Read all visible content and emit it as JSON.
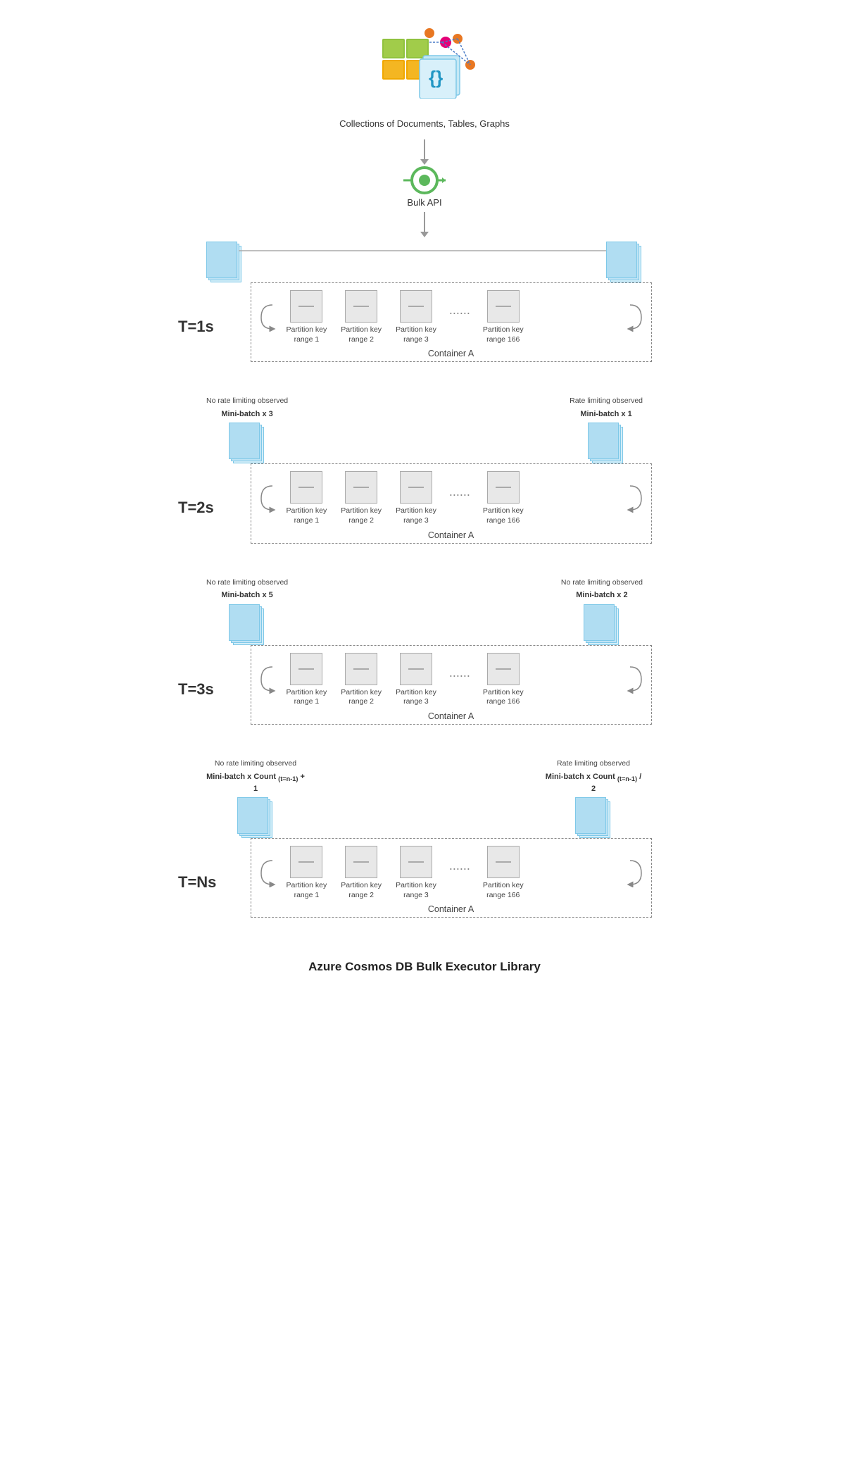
{
  "header": {
    "collections_label": "Collections of Documents, Tables, Graphs",
    "bulk_api_label": "Bulk API"
  },
  "sections": [
    {
      "time_label": "T=1s",
      "left_note": null,
      "left_batch_label": null,
      "right_note": null,
      "right_batch_label": null,
      "has_top_bar": true,
      "container_label": "Container A",
      "partitions": [
        {
          "label": "Partition key\nrange 1"
        },
        {
          "label": "Partition key\nrange 2"
        },
        {
          "label": "Partition key\nrange 3"
        },
        {
          "label": "Partition key\nrange 166"
        }
      ]
    },
    {
      "time_label": "T=2s",
      "left_note_line1": "No rate limiting observed",
      "left_note_line2": "Mini-batch x 3",
      "right_note_line1": "Rate limiting observed",
      "right_note_line2": "Mini-batch x 1",
      "container_label": "Container A",
      "partitions": [
        {
          "label": "Partition key\nrange 1"
        },
        {
          "label": "Partition key\nrange 2"
        },
        {
          "label": "Partition key\nrange 3"
        },
        {
          "label": "Partition key\nrange 166"
        }
      ]
    },
    {
      "time_label": "T=3s",
      "left_note_line1": "No rate limiting observed",
      "left_note_line2": "Mini-batch x 5",
      "right_note_line1": "No rate limiting observed",
      "right_note_line2": "Mini-batch x 2",
      "container_label": "Container A",
      "partitions": [
        {
          "label": "Partition key\nrange 1"
        },
        {
          "label": "Partition key\nrange 2"
        },
        {
          "label": "Partition key\nrange 3"
        },
        {
          "label": "Partition key\nrange 166"
        }
      ]
    },
    {
      "time_label": "T=Ns",
      "left_note_line1": "No rate limiting observed",
      "left_note_line2": "Mini-batch x Count ₍ₜ₌ₙ₋₁₎ + 1",
      "right_note_line1": "Rate limiting observed",
      "right_note_line2": "Mini-batch x Count ₍ₜ₌ₙ₋₁₎ / 2",
      "container_label": "Container A",
      "partitions": [
        {
          "label": "Partition key\nrange 1"
        },
        {
          "label": "Partition key\nrange 2"
        },
        {
          "label": "Partition key\nrange 3"
        },
        {
          "label": "Partition key\nrange 166"
        }
      ]
    }
  ],
  "footer": {
    "title": "Azure Cosmos DB Bulk Executor Library"
  },
  "icons": {
    "dots": "......",
    "container_a": "Container A"
  }
}
